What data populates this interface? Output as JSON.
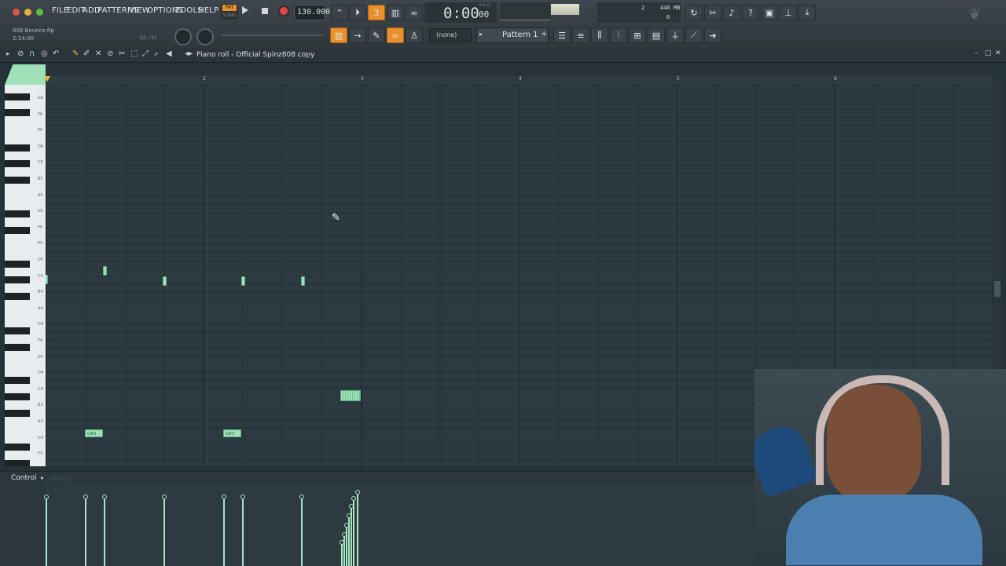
{
  "menu": [
    "FILE",
    "EDIT",
    "ADD",
    "PATTERNS",
    "VIEW",
    "OPTIONS",
    "TOOLS",
    "HELP"
  ],
  "pat_song": {
    "pat": "PAT",
    "song": "SONG"
  },
  "tempo": "130.000",
  "time": {
    "display": "0:00",
    "small": "00",
    "label": "M:S:CS"
  },
  "cpu": {
    "mem": "446 MB",
    "num1": "2",
    "num2": "0"
  },
  "project": {
    "file": "808 Bounce.flp",
    "time": "2:14:00",
    "note": "G5 / 67"
  },
  "snap": "(none)",
  "pattern": "Pattern 1",
  "piano_roll": {
    "title": "Piano roll - Official Spinz808 copy"
  },
  "ruler_bars": [
    "2",
    "3",
    "4",
    "5",
    "6"
  ],
  "key_labels": [
    "G6",
    "F6",
    "E6",
    "D6",
    "C6",
    "B5",
    "A5",
    "G5",
    "F5",
    "E5",
    "D5",
    "C5",
    "B4",
    "A4",
    "G4",
    "F4",
    "E4",
    "D4",
    "C4",
    "B3",
    "A3",
    "G3",
    "F3"
  ],
  "control": {
    "label": "Control",
    "sub": "Velocity"
  },
  "note_labels": [
    "G#3",
    "G#3"
  ],
  "colors": {
    "accent": "#e8902c",
    "note": "#9fe0b8",
    "grid": "#2d3a41"
  }
}
